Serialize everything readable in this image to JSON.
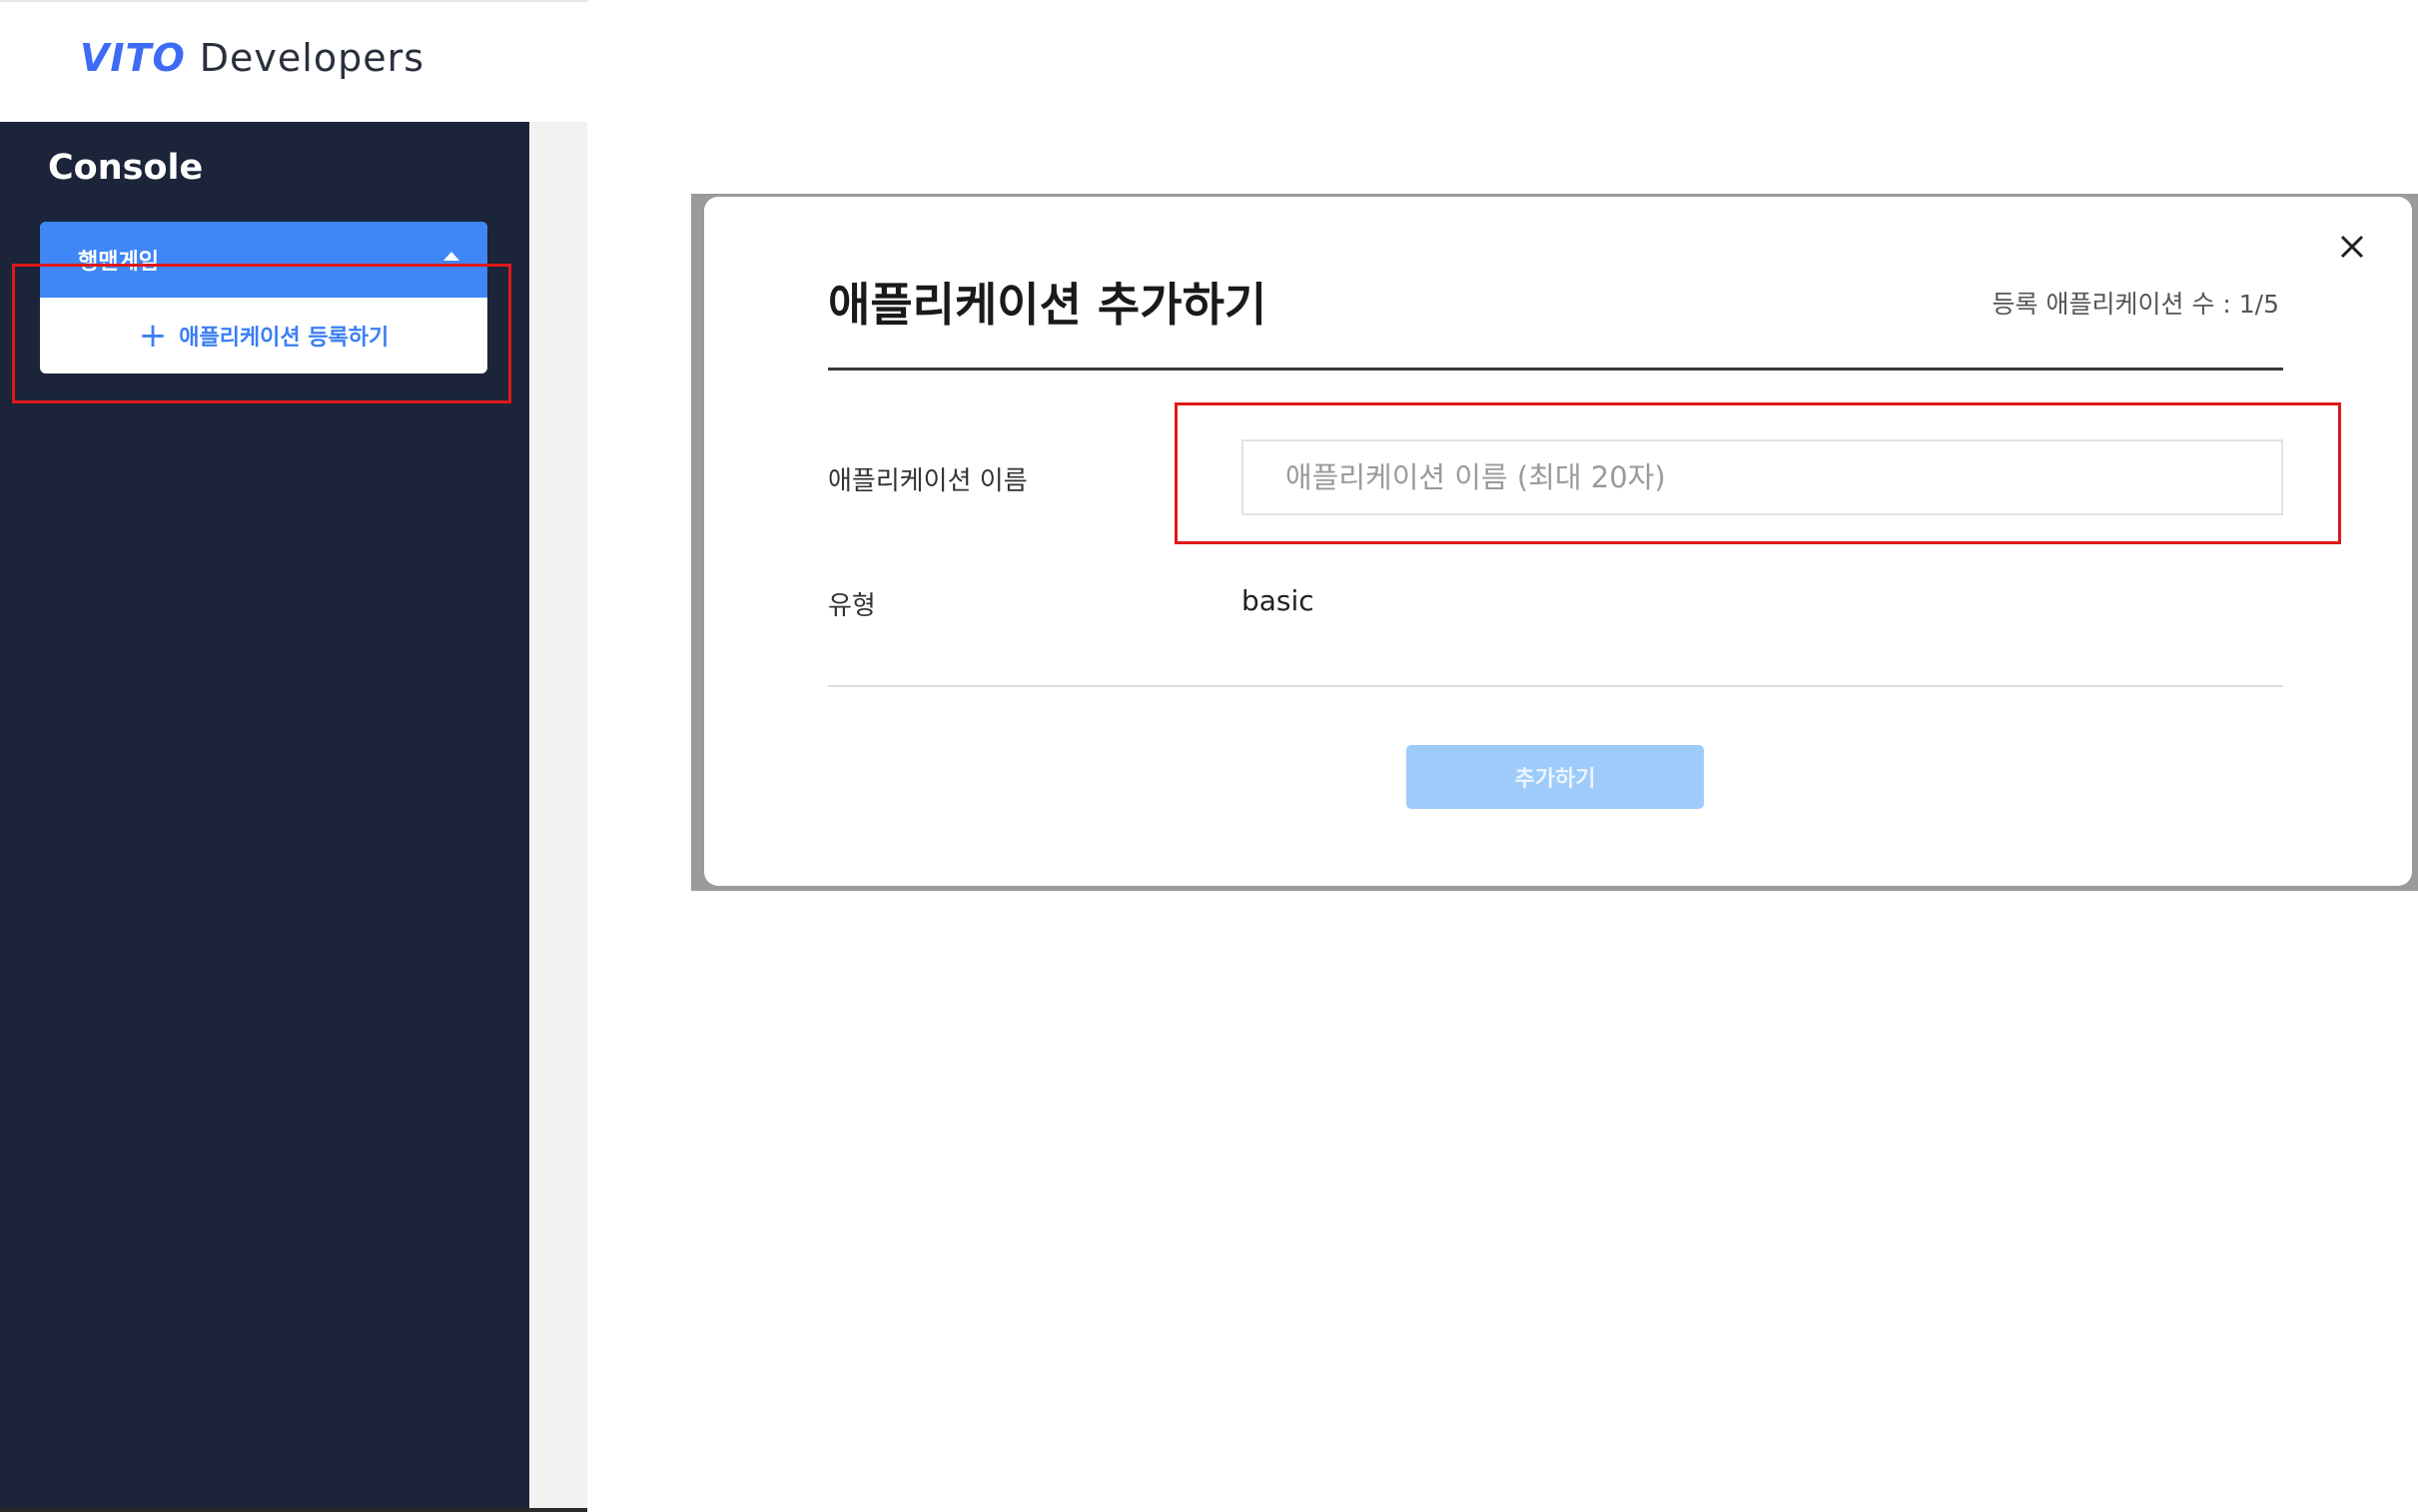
{
  "header": {
    "brand": "VITO",
    "subtitle": "Developers"
  },
  "sidebar": {
    "title": "Console",
    "project": {
      "name": "행맨게임",
      "menu_item_label": "애플리케이션 등록하기",
      "menu_item_icon": "plus-icon"
    }
  },
  "modal": {
    "title": "애플리케이션 추가하기",
    "app_count": "등록 애플리케이션 수 : 1/5",
    "fields": {
      "name_label": "애플리케이션 이름",
      "name_value": "",
      "name_placeholder": "애플리케이션 이름 (최대 20자)",
      "type_label": "유형",
      "type_value": "basic"
    },
    "submit_label": "추가하기",
    "close_icon": "close-icon"
  },
  "colors": {
    "sidebar_bg": "#1b2439",
    "accent": "#3f86f7",
    "disabled_button": "#9fcbfa",
    "highlight": "#e01818"
  }
}
